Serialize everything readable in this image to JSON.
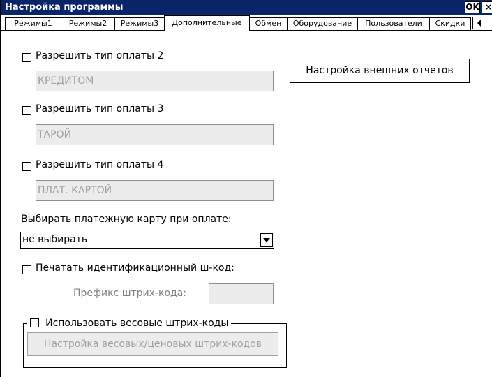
{
  "window": {
    "title": "Настройка программы",
    "ok_label": "OK",
    "close_label": "×"
  },
  "tabs": [
    {
      "label": "Режимы1",
      "active": false
    },
    {
      "label": "Режимы2",
      "active": false
    },
    {
      "label": "Режимы3",
      "active": false
    },
    {
      "label": "Дополнительные",
      "active": true
    },
    {
      "label": "Обмен",
      "active": false
    },
    {
      "label": "Оборудование",
      "active": false
    },
    {
      "label": "Пользователи",
      "active": false
    },
    {
      "label": "Скидки",
      "active": false
    }
  ],
  "tab_scroll_icon": "scroll-left-icon",
  "payment2": {
    "label": "Разрешить тип оплаты 2",
    "checked": false,
    "value": "КРЕДИТОМ"
  },
  "payment3": {
    "label": "Разрешить тип оплаты 3",
    "checked": false,
    "value": "ТАРОЙ"
  },
  "payment4": {
    "label": "Разрешить тип оплаты 4",
    "checked": false,
    "value": "ПЛАТ. КАРТОЙ"
  },
  "external_reports_button": "Настройка внешних отчетов",
  "card_select": {
    "label": "Выбирать платежную карту при оплате:",
    "value": "не выбирать"
  },
  "print_barcode": {
    "label": "Печатать идентификационный ш-код:",
    "checked": false
  },
  "prefix": {
    "label": "Префикс штрих-кода:",
    "value": ""
  },
  "weight_barcodes": {
    "label": "Использовать весовые штрих-коды",
    "checked": false,
    "button": "Настройка весовых/ценовых штрих-кодов"
  },
  "colors": {
    "titlebar": "#0a246a",
    "disabled_field": "#ececec",
    "disabled_text": "#a0a0a0"
  }
}
